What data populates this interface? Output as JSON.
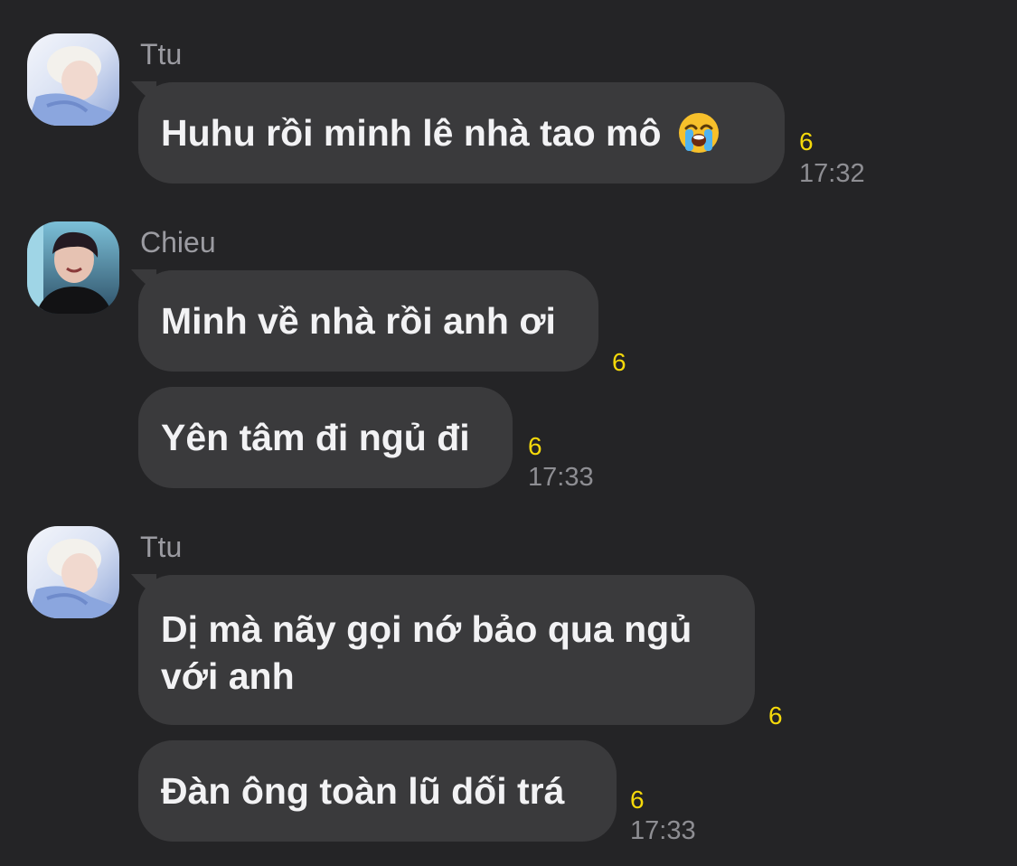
{
  "colors": {
    "background": "#242426",
    "bubble": "#3a3a3c",
    "text": "#f2f2f4",
    "sender": "#9b9ba1",
    "count": "#f5d90a",
    "time": "#8e8e93"
  },
  "messages": [
    {
      "sender": "Ttu",
      "avatar_icon": "avatar-ttu",
      "text": "Huhu rồi minh lê nhà tao mô",
      "emoji_icon": "loudly-crying-face-icon",
      "count": "6",
      "time": "17:32"
    },
    {
      "sender": "Chieu",
      "avatar_icon": "avatar-chieu",
      "text": "Minh về nhà rồi anh ơi",
      "count": "6"
    },
    {
      "text": "Yên tâm đi ngủ đi",
      "count": "6",
      "time": "17:33"
    },
    {
      "sender": "Ttu",
      "avatar_icon": "avatar-ttu",
      "text": "Dị mà nãy gọi nớ bảo qua ngủ\nvới anh",
      "count": "6"
    },
    {
      "text": "Đàn ông toàn lũ dối trá",
      "count": "6",
      "time": "17:33"
    }
  ]
}
